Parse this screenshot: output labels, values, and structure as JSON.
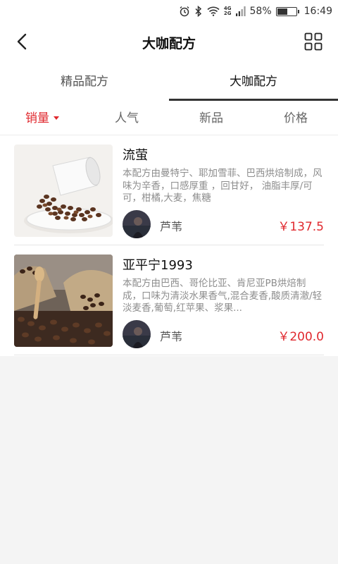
{
  "status": {
    "percent": "58%",
    "time": "16:49",
    "net": [
      "4G",
      "2G"
    ],
    "battery_level": 0.58
  },
  "header": {
    "title": "大咖配方"
  },
  "tabs": [
    {
      "label": "精品配方"
    },
    {
      "label": "大咖配方"
    }
  ],
  "sort": [
    {
      "label": "销量"
    },
    {
      "label": "人气"
    },
    {
      "label": "新品"
    },
    {
      "label": "价格"
    }
  ],
  "items": [
    {
      "name": "流萤",
      "desc": "本配方由曼特宁、耶加雪菲、巴西烘焙制成，风味为辛香，口感厚重 ，回甘好， 油脂丰厚/可可，柑橘,大麦，焦糖",
      "author": "芦苇",
      "price": "￥137.5"
    },
    {
      "name": "亚平宁1993",
      "desc": "本配方由巴西、哥伦比亚、肯尼亚PB烘焙制成，口味为清淡水果香气,混合麦香,酸质清澈/轻淡麦香,葡萄,红苹果、浆果...",
      "author": "芦苇",
      "price": "￥200.0"
    }
  ]
}
